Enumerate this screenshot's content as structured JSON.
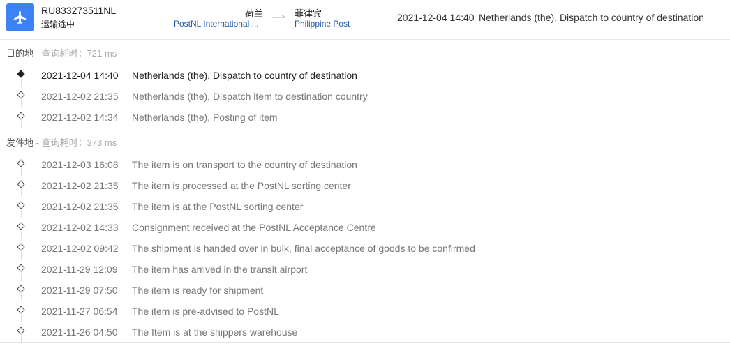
{
  "header": {
    "icon": "airplane-icon",
    "tracking_number": "RU833273511NL",
    "status": "运输途中",
    "origin_country": "荷兰",
    "origin_carrier": "PostNL International ...",
    "dest_country": "菲律宾",
    "dest_carrier": "Philippine Post",
    "latest_time": "2021-12-04 14:40",
    "latest_desc": "Netherlands (the), Dispatch to country of destination"
  },
  "colors": {
    "accent": "#3b82f6",
    "link": "#1f5aa6"
  },
  "destination": {
    "title": "目的地",
    "subtitle": " - 查询耗时：721 ms",
    "events": [
      {
        "time": "2021-12-04 14:40",
        "desc": "Netherlands (the), Dispatch to country of destination",
        "latest": true
      },
      {
        "time": "2021-12-02 21:35",
        "desc": "Netherlands (the), Dispatch item to destination country"
      },
      {
        "time": "2021-12-02 14:34",
        "desc": "Netherlands (the), Posting of item"
      }
    ]
  },
  "origin": {
    "title": "发件地",
    "subtitle": " - 查询耗时：373 ms",
    "events": [
      {
        "time": "2021-12-03 16:08",
        "desc": "The item is on transport to the country of destination"
      },
      {
        "time": "2021-12-02 21:35",
        "desc": "The item is processed at the PostNL sorting center"
      },
      {
        "time": "2021-12-02 21:35",
        "desc": "The item is at the PostNL sorting center"
      },
      {
        "time": "2021-12-02 14:33",
        "desc": "Consignment received at the PostNL Acceptance Centre"
      },
      {
        "time": "2021-12-02 09:42",
        "desc": "The shipment is handed over in bulk, final acceptance of goods to be confirmed"
      },
      {
        "time": "2021-11-29 12:09",
        "desc": "The item has arrived in the transit airport"
      },
      {
        "time": "2021-11-29 07:50",
        "desc": "The item is ready for shipment"
      },
      {
        "time": "2021-11-27 06:54",
        "desc": "The item is pre-advised to PostNL"
      },
      {
        "time": "2021-11-26 04:50",
        "desc": "The Item is at the shippers warehouse"
      }
    ]
  }
}
